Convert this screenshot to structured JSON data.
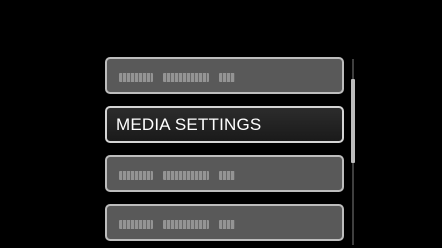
{
  "menu": {
    "items": [
      {
        "label": "",
        "obscured": true
      },
      {
        "label": "MEDIA SETTINGS",
        "obscured": false,
        "selected": true
      },
      {
        "label": "",
        "obscured": true
      },
      {
        "label": "",
        "obscured": true
      }
    ]
  },
  "scrollbar": {
    "position_fraction": 0.2,
    "visible_fraction": 0.45
  },
  "colors": {
    "background": "#000000",
    "item_background": "#595959",
    "item_border": "#bdbdbd",
    "selected_background": "#1f1f1f",
    "text": "#ffffff"
  }
}
